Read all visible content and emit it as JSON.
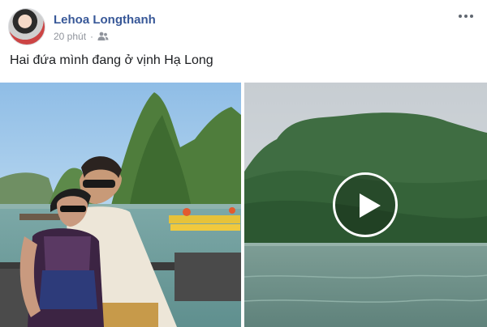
{
  "post": {
    "author": "Lehoa Longthanh",
    "time": "20 phút",
    "separator": "·",
    "audience_icon": "friends-icon",
    "more_icon": "more-dots-icon",
    "caption": "Hai đứa mình đang ở vịnh Hạ Long"
  },
  "media": {
    "photo_icon": "photo",
    "video_icon": "play-icon"
  },
  "colors": {
    "author_link": "#385898",
    "meta_text": "#90949c",
    "text": "#1c1e21"
  }
}
